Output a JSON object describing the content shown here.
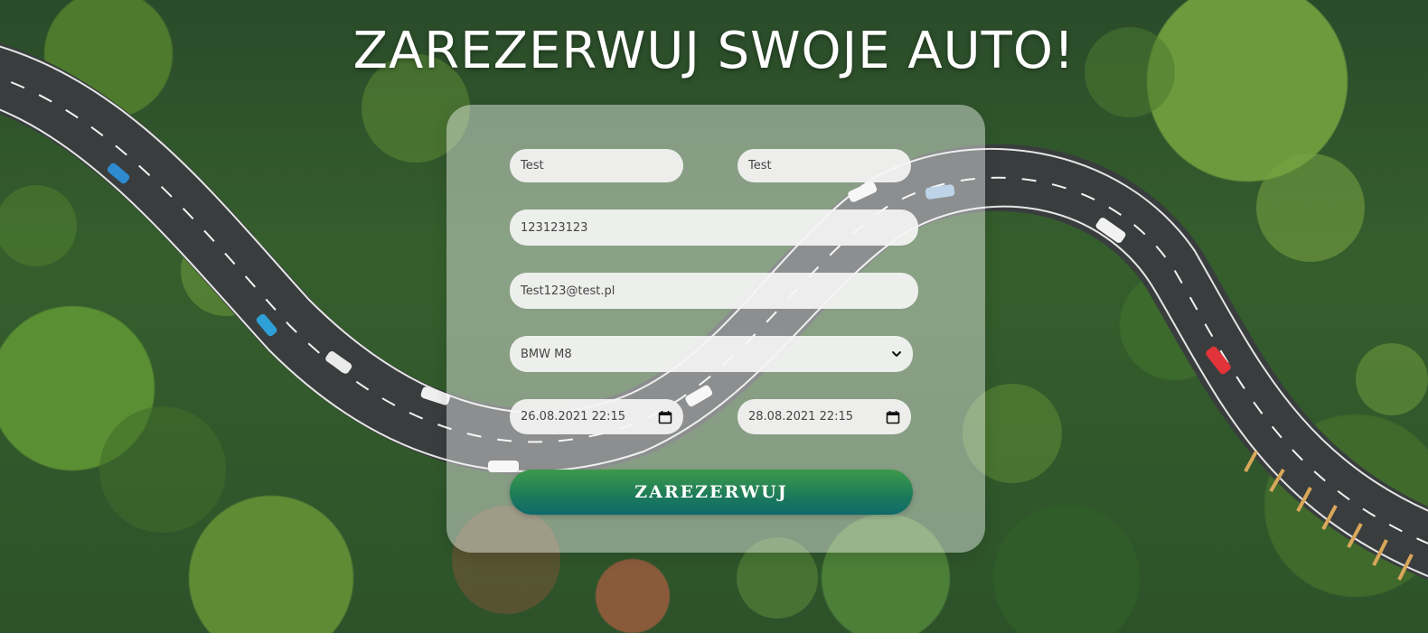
{
  "page": {
    "title": "ZAREZERWUJ SWOJE AUTO!"
  },
  "form": {
    "first_name": "Test",
    "last_name": "Test",
    "phone": "123123123",
    "email": "Test123@test.pl",
    "car_selected": "BMW M8",
    "date_from": "26.08.2021 22:15",
    "date_to": "28.08.2021 22:15",
    "submit_label": "ZAREZERWUJ"
  },
  "icons": {
    "calendar": "calendar-icon",
    "dropdown": "chevron-down-icon"
  },
  "colors": {
    "button_top": "#3c9a4a",
    "button_bottom": "#0f6a6a",
    "title": "#ffffff"
  }
}
